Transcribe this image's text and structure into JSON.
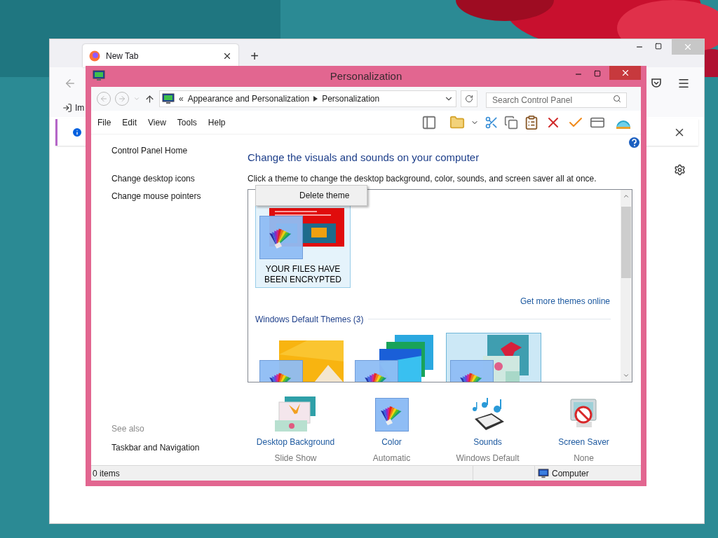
{
  "browser": {
    "tab_title": "New Tab",
    "new_tab": "+",
    "bookmark": "Im"
  },
  "window": {
    "title": "Personalization"
  },
  "address_bar": {
    "prefix": "«",
    "crumbs": [
      "Appearance and Personalization",
      "Personalization"
    ]
  },
  "search": {
    "placeholder": "Search Control Panel"
  },
  "menu": [
    "File",
    "Edit",
    "View",
    "Tools",
    "Help"
  ],
  "sidebar": {
    "links": [
      "Control Panel Home",
      "Change desktop icons",
      "Change mouse pointers"
    ],
    "see_also_title": "See also",
    "see_also": [
      "Taskbar and Navigation"
    ]
  },
  "heading": "Change the visuals and sounds on your computer",
  "subheading": "Click a theme to change the desktop background, color, sounds, and screen saver all at once.",
  "context_menu": {
    "items": [
      "Delete theme"
    ]
  },
  "my_themes": [
    {
      "name": "YOUR FILES HAVE BEEN ENCRYPTED",
      "kind": "ransom",
      "selected": false,
      "hovered": true
    }
  ],
  "get_more": "Get more themes online",
  "group_title": "Windows Default Themes (3)",
  "default_themes": [
    {
      "kind": "yellow",
      "selected": false,
      "hovered": false
    },
    {
      "kind": "blue",
      "selected": false,
      "hovered": false
    },
    {
      "kind": "flowers",
      "selected": true,
      "hovered": false
    }
  ],
  "settings": [
    {
      "kind": "background",
      "label": "Desktop Background",
      "value": "Slide Show"
    },
    {
      "kind": "color",
      "label": "Color",
      "value": "Automatic"
    },
    {
      "kind": "sounds",
      "label": "Sounds",
      "value": "Windows Default"
    },
    {
      "kind": "screensaver",
      "label": "Screen Saver",
      "value": "None"
    }
  ],
  "status_bar": {
    "items": "0 items",
    "location": "Computer"
  }
}
